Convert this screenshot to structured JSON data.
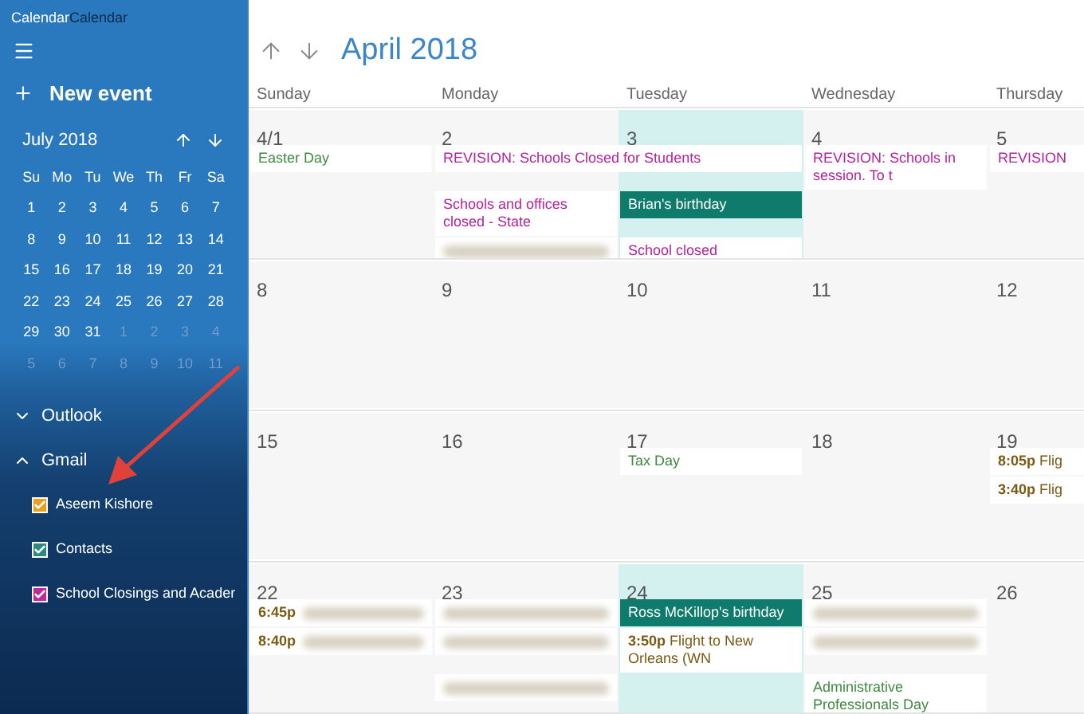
{
  "app_title": [
    "Calendar",
    "Calendar"
  ],
  "sidebar": {
    "new_event": "New event",
    "mini_calendar": {
      "month": "July 2018",
      "weekdays": [
        "Su",
        "Mo",
        "Tu",
        "We",
        "Th",
        "Fr",
        "Sa"
      ],
      "weeks": [
        [
          {
            "day": "1",
            "in_month": true
          },
          {
            "day": "2",
            "in_month": true
          },
          {
            "day": "3",
            "in_month": true
          },
          {
            "day": "4",
            "in_month": true
          },
          {
            "day": "5",
            "in_month": true
          },
          {
            "day": "6",
            "in_month": true
          },
          {
            "day": "7",
            "in_month": true
          }
        ],
        [
          {
            "day": "8",
            "in_month": true
          },
          {
            "day": "9",
            "in_month": true
          },
          {
            "day": "10",
            "in_month": true
          },
          {
            "day": "11",
            "in_month": true
          },
          {
            "day": "12",
            "in_month": true
          },
          {
            "day": "13",
            "in_month": true
          },
          {
            "day": "14",
            "in_month": true
          }
        ],
        [
          {
            "day": "15",
            "in_month": true
          },
          {
            "day": "16",
            "in_month": true
          },
          {
            "day": "17",
            "in_month": true
          },
          {
            "day": "18",
            "in_month": true
          },
          {
            "day": "19",
            "in_month": true
          },
          {
            "day": "20",
            "in_month": true
          },
          {
            "day": "21",
            "in_month": true
          }
        ],
        [
          {
            "day": "22",
            "in_month": true
          },
          {
            "day": "23",
            "in_month": true
          },
          {
            "day": "24",
            "in_month": true
          },
          {
            "day": "25",
            "in_month": true
          },
          {
            "day": "26",
            "in_month": true
          },
          {
            "day": "27",
            "in_month": true
          },
          {
            "day": "28",
            "in_month": true
          }
        ],
        [
          {
            "day": "29",
            "in_month": true
          },
          {
            "day": "30",
            "in_month": true
          },
          {
            "day": "31",
            "in_month": true
          },
          {
            "day": "1",
            "in_month": false
          },
          {
            "day": "2",
            "in_month": false
          },
          {
            "day": "3",
            "in_month": false
          },
          {
            "day": "4",
            "in_month": false
          }
        ],
        [
          {
            "day": "5",
            "in_month": false
          },
          {
            "day": "6",
            "in_month": false
          },
          {
            "day": "7",
            "in_month": false
          },
          {
            "day": "8",
            "in_month": false
          },
          {
            "day": "9",
            "in_month": false
          },
          {
            "day": "10",
            "in_month": false
          },
          {
            "day": "11",
            "in_month": false
          }
        ]
      ]
    },
    "accounts": [
      {
        "name": "Outlook",
        "expanded": false
      },
      {
        "name": "Gmail",
        "expanded": true,
        "calendars": [
          {
            "name": "Aseem Kishore",
            "checked": true,
            "color": "#e8a01e"
          },
          {
            "name": "Contacts",
            "checked": true,
            "color": "#2e8a80"
          },
          {
            "name": "School Closings and Acader",
            "checked": true,
            "color": "#c2289e"
          }
        ]
      }
    ]
  },
  "main": {
    "title": "April 2018",
    "weekdays": [
      "Sunday",
      "Monday",
      "Tuesday",
      "Wednesday",
      "Thursday"
    ],
    "weeks": [
      {
        "days": [
          {
            "day": "4/1",
            "today": false,
            "events": [
              {
                "kind": "allday",
                "text": "Easter Day",
                "color": "#3f8a3f"
              }
            ]
          },
          {
            "day": "2",
            "today": false,
            "events": [
              {
                "kind": "allday",
                "text": "REVISION: Schools Closed for Students",
                "color": "#b4239c",
                "continues": true
              },
              {
                "kind": "allday",
                "text": "Schools and offices closed - State",
                "color": "#b4239c"
              },
              {
                "kind": "blurred"
              }
            ]
          },
          {
            "day": "3",
            "today": true,
            "events": [
              {
                "kind": "birthday",
                "text": "Brian's birthday",
                "color": "#0f7b6c"
              },
              {
                "kind": "allday",
                "text": "School closed",
                "color": "#b4239c"
              }
            ]
          },
          {
            "day": "4",
            "today": false,
            "events": [
              {
                "kind": "allday",
                "text": "REVISION: Schools in session. To t",
                "color": "#b4239c"
              }
            ]
          },
          {
            "day": "5",
            "today": false,
            "events": [
              {
                "kind": "allday",
                "text": "REVISION",
                "color": "#b4239c"
              }
            ]
          }
        ]
      },
      {
        "days": [
          {
            "day": "8",
            "today": false
          },
          {
            "day": "9",
            "today": false
          },
          {
            "day": "10",
            "today": false
          },
          {
            "day": "11",
            "today": false
          },
          {
            "day": "12",
            "today": false
          }
        ]
      },
      {
        "days": [
          {
            "day": "15",
            "today": false
          },
          {
            "day": "16",
            "today": false
          },
          {
            "day": "17",
            "today": false,
            "events": [
              {
                "kind": "allday",
                "text": "Tax Day",
                "color": "#3f8a3f"
              }
            ]
          },
          {
            "day": "18",
            "today": false
          },
          {
            "day": "19",
            "today": false,
            "events": [
              {
                "kind": "timed",
                "time": "8:05p",
                "text": "Flig",
                "color": "#7a5a14"
              },
              {
                "kind": "timed",
                "time": "3:40p",
                "text": "Flig",
                "color": "#7a5a14"
              }
            ]
          }
        ]
      },
      {
        "days": [
          {
            "day": "22",
            "today": false,
            "events": [
              {
                "kind": "blurred",
                "time": "6:45p",
                "color": "#7a5a14"
              },
              {
                "kind": "blurred",
                "time": "8:40p",
                "color": "#7a5a14"
              }
            ]
          },
          {
            "day": "23",
            "today": false,
            "events": [
              {
                "kind": "blurred"
              },
              {
                "kind": "blurred"
              },
              {
                "kind": "blurred"
              }
            ]
          },
          {
            "day": "24",
            "today": true,
            "events": [
              {
                "kind": "birthday",
                "text": "Ross McKillop's birthday",
                "color": "#0f7b6c"
              },
              {
                "kind": "timed",
                "time": "3:50p",
                "text": "Flight to New Orleans (WN",
                "color": "#7a5a14"
              }
            ]
          },
          {
            "day": "25",
            "today": false,
            "events": [
              {
                "kind": "blurred"
              },
              {
                "kind": "blurred"
              },
              {
                "kind": "allday",
                "text": "Administrative Professionals Day",
                "color": "#3f8a3f"
              }
            ]
          },
          {
            "day": "26",
            "today": false
          }
        ]
      }
    ]
  }
}
